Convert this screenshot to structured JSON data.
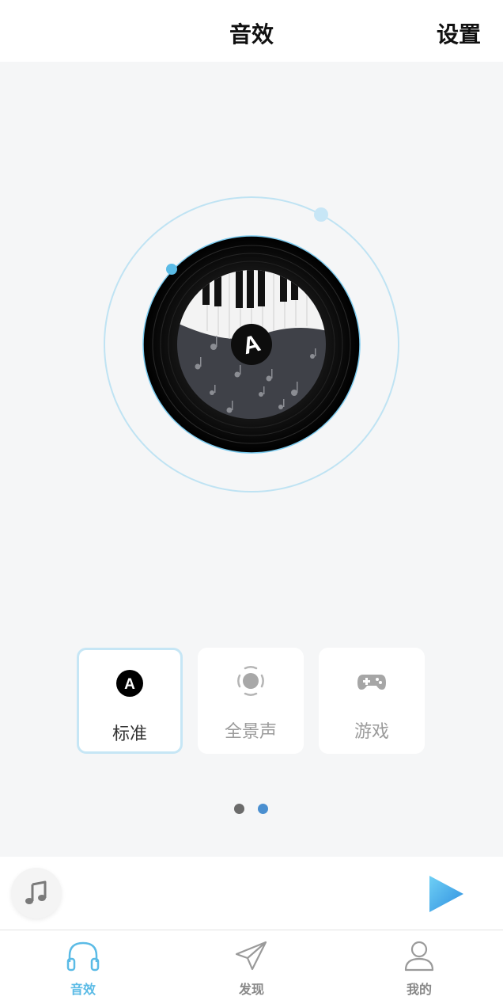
{
  "header": {
    "title": "音效",
    "settings_label": "设置"
  },
  "modes": [
    {
      "label": "标准",
      "icon": "a-badge-icon",
      "selected": true
    },
    {
      "label": "全景声",
      "icon": "surround-icon",
      "selected": false
    },
    {
      "label": "游戏",
      "icon": "gamepad-icon",
      "selected": false
    }
  ],
  "badge_letter": "A",
  "pager": {
    "total": 2,
    "current": 2
  },
  "player": {
    "music_icon": "music-note-icon",
    "play_icon": "play-icon"
  },
  "tabs": [
    {
      "label": "音效",
      "icon": "headphones-icon",
      "active": true
    },
    {
      "label": "发现",
      "icon": "paper-plane-icon",
      "active": false
    },
    {
      "label": "我的",
      "icon": "person-icon",
      "active": false
    }
  ],
  "colors": {
    "accent": "#5bbbe6",
    "ring": "#bfe3f3",
    "dot_inactive": "#6b6b6b",
    "dot_active": "#4a8fd0",
    "background": "#f5f6f7"
  }
}
